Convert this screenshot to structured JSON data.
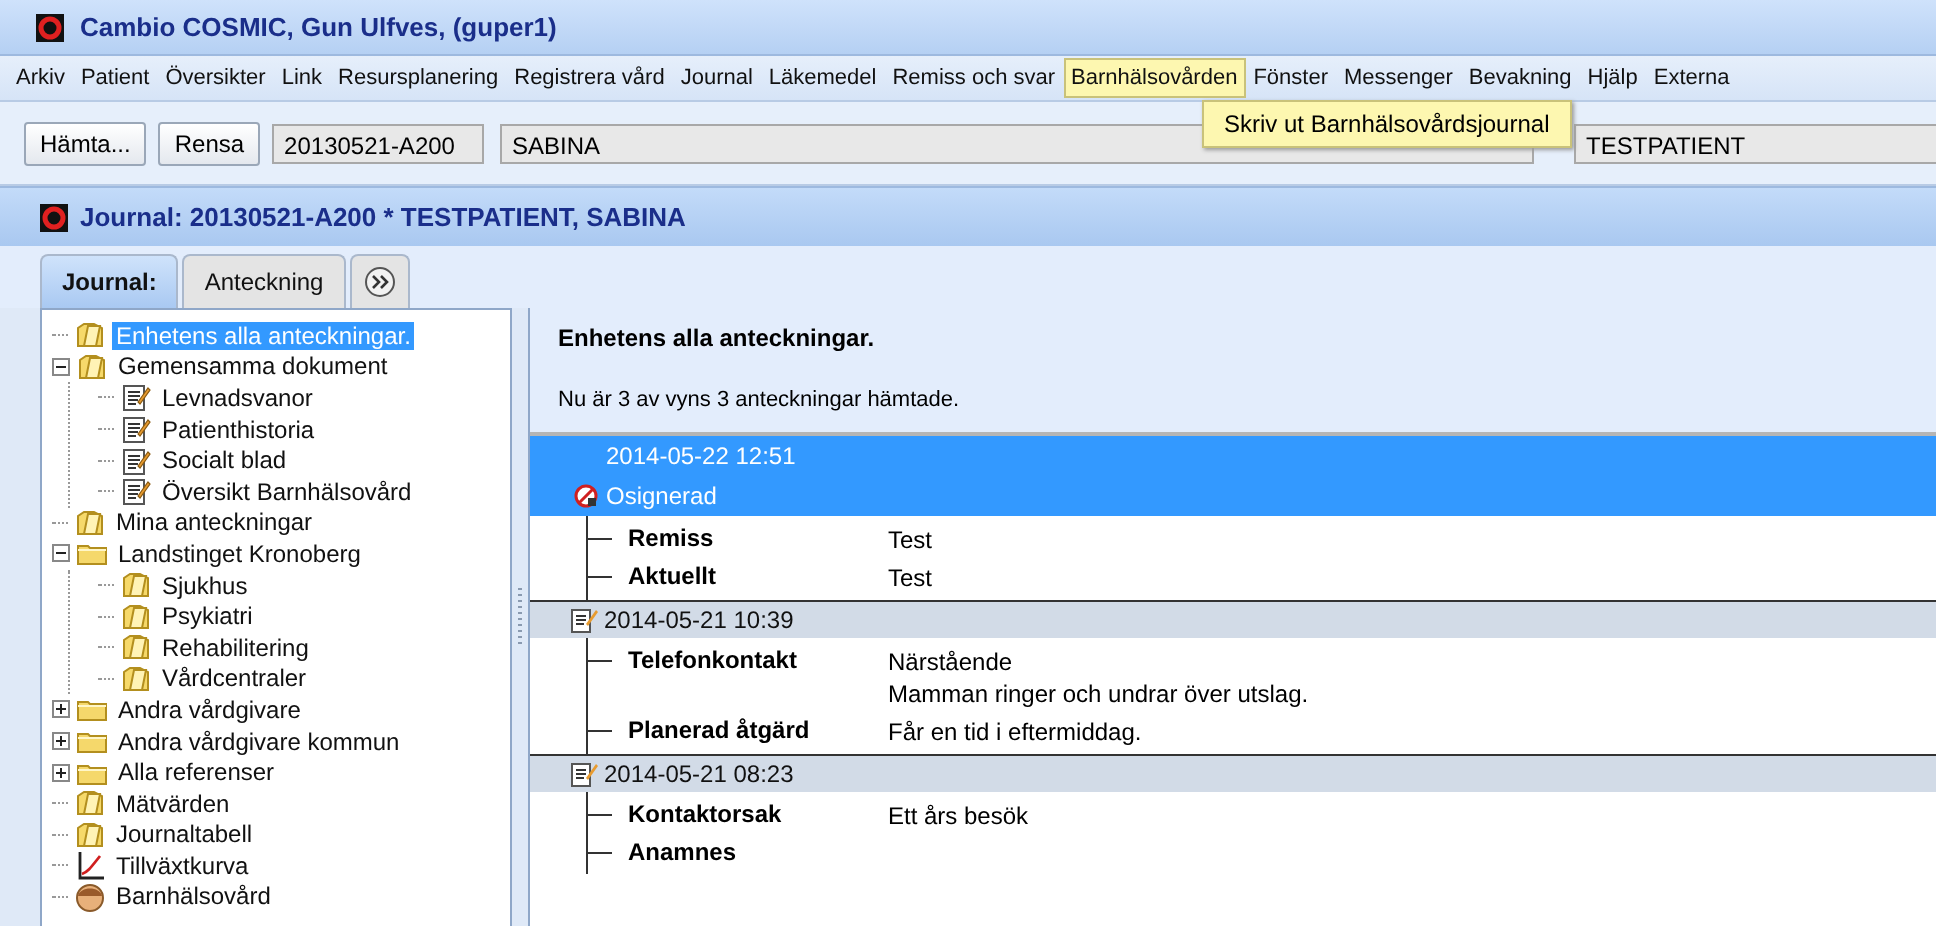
{
  "window": {
    "title": "Cambio COSMIC, Gun  Ulfves, (guper1)"
  },
  "menu": [
    {
      "label": "Arkiv",
      "selected": false
    },
    {
      "label": "Patient",
      "selected": false
    },
    {
      "label": "Översikter",
      "selected": false
    },
    {
      "label": "Link",
      "selected": false
    },
    {
      "label": "Resursplanering",
      "selected": false
    },
    {
      "label": "Registrera vård",
      "selected": false
    },
    {
      "label": "Journal",
      "selected": false
    },
    {
      "label": "Läkemedel",
      "selected": false
    },
    {
      "label": "Remiss och svar",
      "selected": false
    },
    {
      "label": "Barnhälsovården",
      "selected": true
    },
    {
      "label": "Fönster",
      "selected": false
    },
    {
      "label": "Messenger",
      "selected": false
    },
    {
      "label": "Bevakning",
      "selected": false
    },
    {
      "label": "Hjälp",
      "selected": false
    },
    {
      "label": "Externa",
      "selected": false
    }
  ],
  "dropdown": {
    "items": [
      "Skriv ut Barnhälsovårdsjournal"
    ]
  },
  "toolbar": {
    "buttons": [
      "Hämta...",
      "Rensa"
    ],
    "fields": [
      {
        "value": "20130521-A200",
        "kind": "short"
      },
      {
        "value": "SABINA",
        "kind": "wide"
      },
      {
        "value": "TESTPATIENT",
        "kind": "end"
      }
    ]
  },
  "journal": {
    "title": "Journal: 20130521-A200 * TESTPATIENT, SABINA",
    "tabs": [
      {
        "label": "Journal:",
        "selected": true
      },
      {
        "label": "Anteckning",
        "selected": false
      }
    ],
    "tree": [
      {
        "label": "Enhetens alla anteckningar.",
        "kind": "note",
        "selected": true
      },
      {
        "label": "Gemensamma dokument",
        "kind": "note",
        "selected": false,
        "expanded": true,
        "children": [
          {
            "label": "Levnadsvanor",
            "kind": "doc",
            "selected": false
          },
          {
            "label": "Patienthistoria",
            "kind": "doc",
            "selected": false
          },
          {
            "label": "Socialt blad",
            "kind": "doc",
            "selected": false
          },
          {
            "label": "Översikt Barnhälsovård",
            "kind": "doc",
            "selected": false
          }
        ]
      },
      {
        "label": "Mina anteckningar",
        "kind": "note",
        "selected": false
      },
      {
        "label": "Landstinget Kronoberg",
        "kind": "folder",
        "selected": false,
        "expanded": true,
        "children": [
          {
            "label": "Sjukhus",
            "kind": "note",
            "selected": false
          },
          {
            "label": "Psykiatri",
            "kind": "note",
            "selected": false
          },
          {
            "label": "Rehabilitering",
            "kind": "note",
            "selected": false
          },
          {
            "label": "Vårdcentraler",
            "kind": "note",
            "selected": false
          }
        ]
      },
      {
        "label": "Andra vårdgivare",
        "kind": "folder",
        "selected": false,
        "expanded": false
      },
      {
        "label": "Andra vårdgivare kommun",
        "kind": "folder",
        "selected": false,
        "expanded": false
      },
      {
        "label": "Alla referenser",
        "kind": "folder",
        "selected": false,
        "expanded": false
      },
      {
        "label": "Mätvärden",
        "kind": "note",
        "selected": false
      },
      {
        "label": "Journaltabell",
        "kind": "note",
        "selected": false
      },
      {
        "label": "Tillväxtkurva",
        "kind": "chart",
        "selected": false
      },
      {
        "label": "Barnhälsovård",
        "kind": "face",
        "selected": false
      }
    ],
    "header": {
      "title": "Enhetens alla anteckningar.",
      "info": "Nu är 3 av vyns 3 anteckningar hämtade."
    },
    "entries": [
      {
        "date": "2014-05-22  12:51",
        "status": "Osignerad",
        "selected": true,
        "fields": [
          {
            "label": "Remiss",
            "values": [
              "Test"
            ]
          },
          {
            "label": "Aktuellt",
            "values": [
              "Test"
            ]
          }
        ]
      },
      {
        "date": "2014-05-21  10:39",
        "selected": false,
        "fields": [
          {
            "label": "Telefonkontakt",
            "values": [
              "Närstående",
              "Mamman ringer och undrar över utslag."
            ]
          },
          {
            "label": "Planerad åtgärd",
            "values": [
              "Får en tid i eftermiddag."
            ]
          }
        ]
      },
      {
        "date": "2014-05-21  08:23",
        "selected": false,
        "fields": [
          {
            "label": "Kontaktorsak",
            "values": [
              "Ett års besök"
            ]
          },
          {
            "label": "Anamnes"
          }
        ]
      }
    ]
  }
}
